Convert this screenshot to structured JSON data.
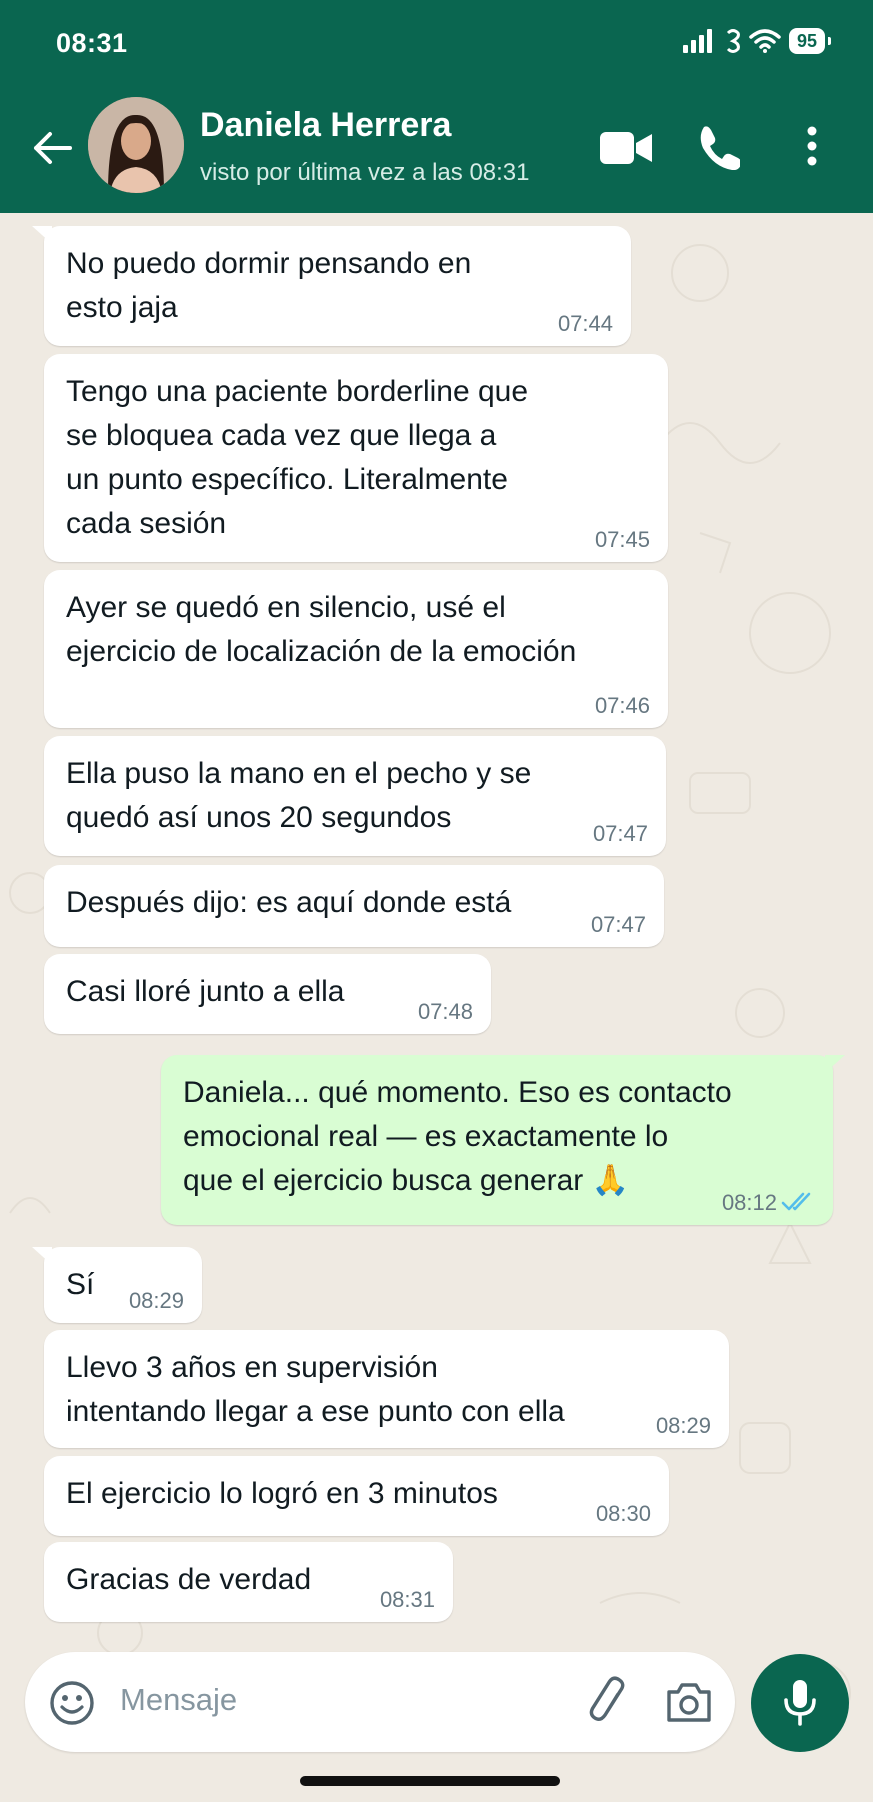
{
  "status_bar": {
    "time": "08:31",
    "battery": "95"
  },
  "header": {
    "contact_name": "Daniela Herrera",
    "contact_status": "visto por última vez a las 08:31"
  },
  "messages": [
    {
      "text": "No puedo dormir pensando en\nesto jaja",
      "time": "07:44"
    },
    {
      "text": "Tengo una paciente borderline que\nse bloquea cada vez que llega a\nun punto específico. Literalmente\ncada sesión",
      "time": "07:45"
    },
    {
      "text": "Ayer se quedó en silencio, usé el\nejercicio de localización de la emoción",
      "time": "07:46"
    },
    {
      "text": "Ella puso la mano en el pecho y se\nquedó así unos 20 segundos",
      "time": "07:47"
    },
    {
      "text": "Después dijo: es aquí donde está",
      "time": "07:47"
    },
    {
      "text": "Casi lloré junto a ella",
      "time": "07:48"
    },
    {
      "text": "Daniela... qué momento. Eso es contacto\nemocional real — es exactamente lo\nque el ejercicio busca generar 🙏",
      "time": "08:12"
    },
    {
      "text": "Sí",
      "time": "08:29"
    },
    {
      "text": "Llevo 3 años en supervisión\nintentando llegar a ese punto con ella",
      "time": "08:29"
    },
    {
      "text": "El ejercicio lo logró en 3 minutos",
      "time": "08:30"
    },
    {
      "text": "Gracias de verdad",
      "time": "08:31"
    }
  ],
  "composer": {
    "placeholder": "Mensaje"
  },
  "colors": {
    "header": "#0a6650",
    "chat_background": "#efeae2",
    "incoming_bubble": "#ffffff",
    "outgoing_bubble": "#d9fdd3",
    "read_ticks": "#53bdeb"
  },
  "icons": [
    "back-arrow-icon",
    "video-call-icon",
    "voice-call-icon",
    "more-vert-icon",
    "emoji-icon",
    "attach-icon",
    "camera-icon",
    "mic-icon",
    "signal-icon",
    "wifi-icon",
    "read-ticks-icon"
  ]
}
